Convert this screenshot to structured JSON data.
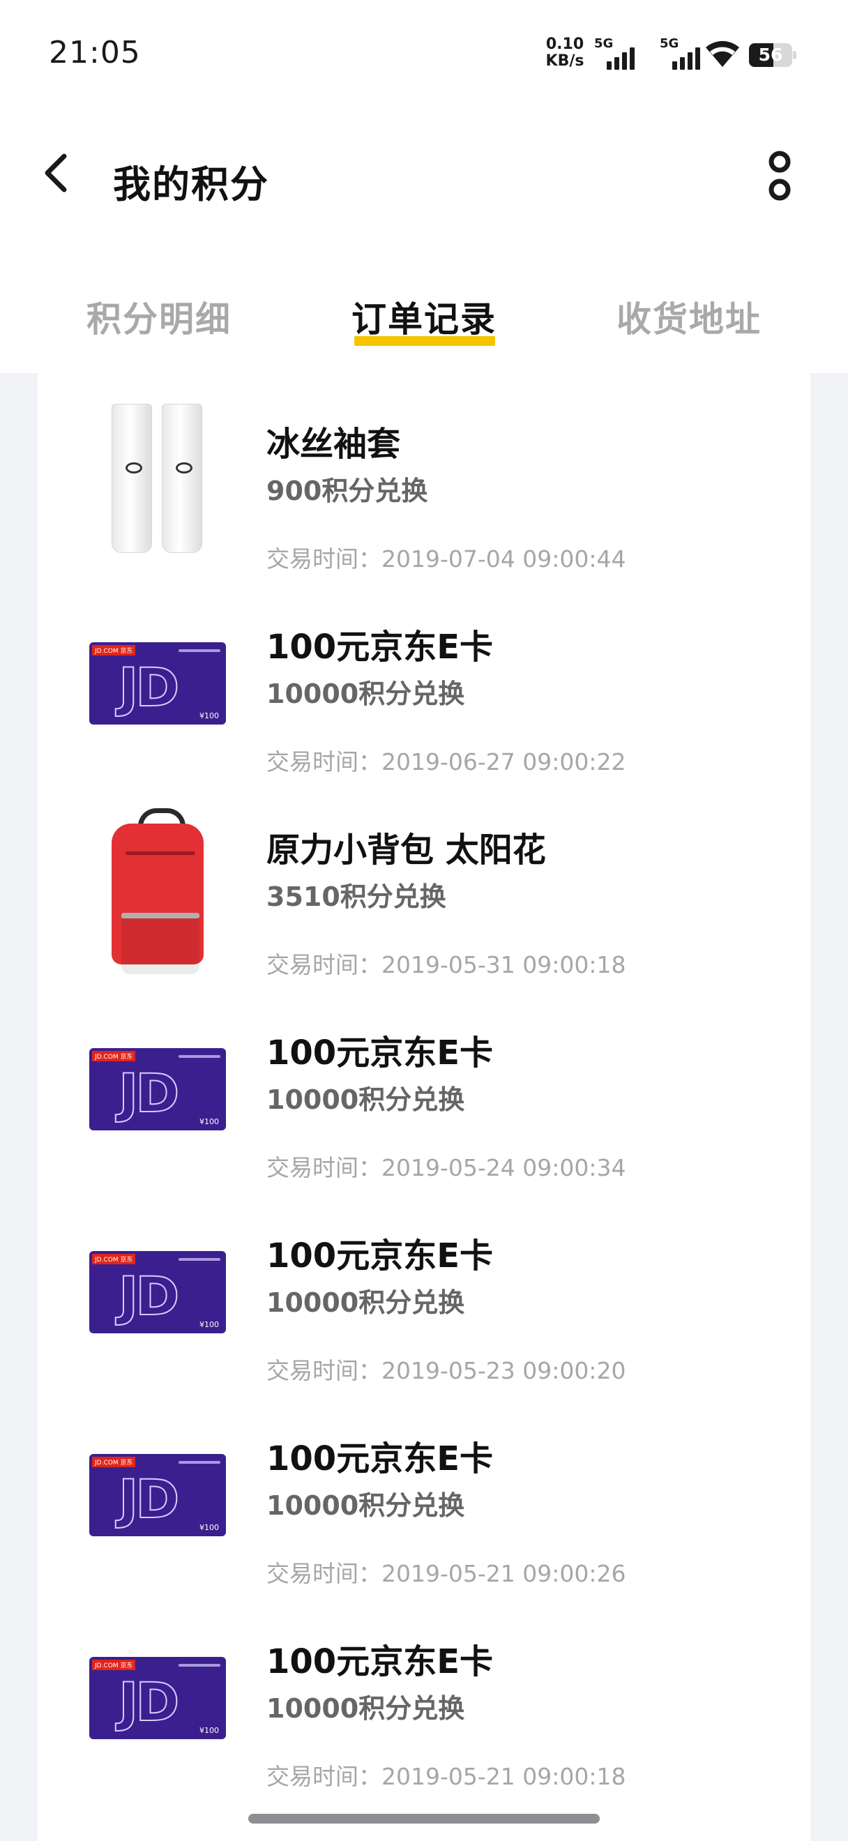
{
  "status_bar": {
    "time": "21:05",
    "net_speed_value": "0.10",
    "net_speed_unit": "KB/s",
    "sim1_label": "5G",
    "sim2_label": "5G",
    "battery_level": "56",
    "wifi_icon": "wifi-icon",
    "signal_icon": "signal-icon"
  },
  "header": {
    "title": "我的积分",
    "back_icon": "chevron-left-icon",
    "more_icon": "more-icon"
  },
  "tabs": [
    {
      "label": "积分明细",
      "active": false
    },
    {
      "label": "订单记录",
      "active": true
    },
    {
      "label": "收货地址",
      "active": false
    }
  ],
  "colors": {
    "accent": "#f5c400",
    "jd_card": "#3b1f8e",
    "backpack_red": "#e23034",
    "page_bg": "#f2f3f7"
  },
  "orders": [
    {
      "image": "ice-sleeves",
      "name": "冰丝袖套",
      "points": "900积分兑换",
      "time": "交易时间：2019-07-04 09:00:44"
    },
    {
      "image": "jd-e-card",
      "name": "100元京东E卡",
      "points": "10000积分兑换",
      "time": "交易时间：2019-06-27 09:00:22"
    },
    {
      "image": "backpack",
      "name": "原力小背包 太阳花",
      "points": "3510积分兑换",
      "time": "交易时间：2019-05-31 09:00:18"
    },
    {
      "image": "jd-e-card",
      "name": "100元京东E卡",
      "points": "10000积分兑换",
      "time": "交易时间：2019-05-24 09:00:34"
    },
    {
      "image": "jd-e-card",
      "name": "100元京东E卡",
      "points": "10000积分兑换",
      "time": "交易时间：2019-05-23 09:00:20"
    },
    {
      "image": "jd-e-card",
      "name": "100元京东E卡",
      "points": "10000积分兑换",
      "time": "交易时间：2019-05-21 09:00:26"
    },
    {
      "image": "jd-e-card",
      "name": "100元京东E卡",
      "points": "10000积分兑换",
      "time": "交易时间：2019-05-21 09:00:18"
    }
  ],
  "jd_card_art": {
    "brand_tag": "JD.COM 京东",
    "logo_text": "JD",
    "face_value": "¥100"
  }
}
